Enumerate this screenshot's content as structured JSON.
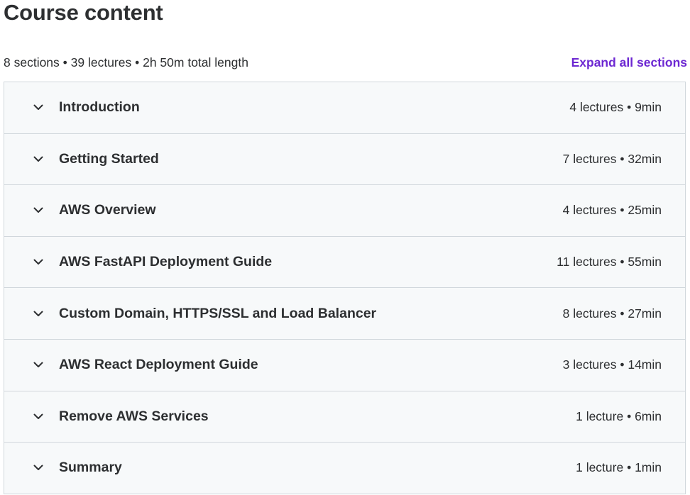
{
  "header": {
    "title": "Course content",
    "summary": "8 sections • 39 lectures • 2h 50m total length",
    "expand_label": "Expand all sections"
  },
  "colors": {
    "accent": "#6d28d2",
    "text": "#2d2f31",
    "section_bg": "#f7f9fa",
    "border": "#d1d7dc"
  },
  "sections": [
    {
      "title": "Introduction",
      "info": "4 lectures • 9min",
      "icon": "chevron-down-icon"
    },
    {
      "title": "Getting Started",
      "info": "7 lectures • 32min",
      "icon": "chevron-down-icon"
    },
    {
      "title": "AWS Overview",
      "info": "4 lectures • 25min",
      "icon": "chevron-down-icon"
    },
    {
      "title": "AWS FastAPI Deployment Guide",
      "info": "11 lectures • 55min",
      "icon": "chevron-down-icon"
    },
    {
      "title": "Custom Domain, HTTPS/SSL and Load Balancer",
      "info": "8 lectures • 27min",
      "icon": "chevron-down-icon"
    },
    {
      "title": "AWS React Deployment Guide",
      "info": "3 lectures • 14min",
      "icon": "chevron-down-icon"
    },
    {
      "title": "Remove AWS Services",
      "info": "1 lecture • 6min",
      "icon": "chevron-down-icon"
    },
    {
      "title": "Summary",
      "info": "1 lecture • 1min",
      "icon": "chevron-down-icon"
    }
  ]
}
